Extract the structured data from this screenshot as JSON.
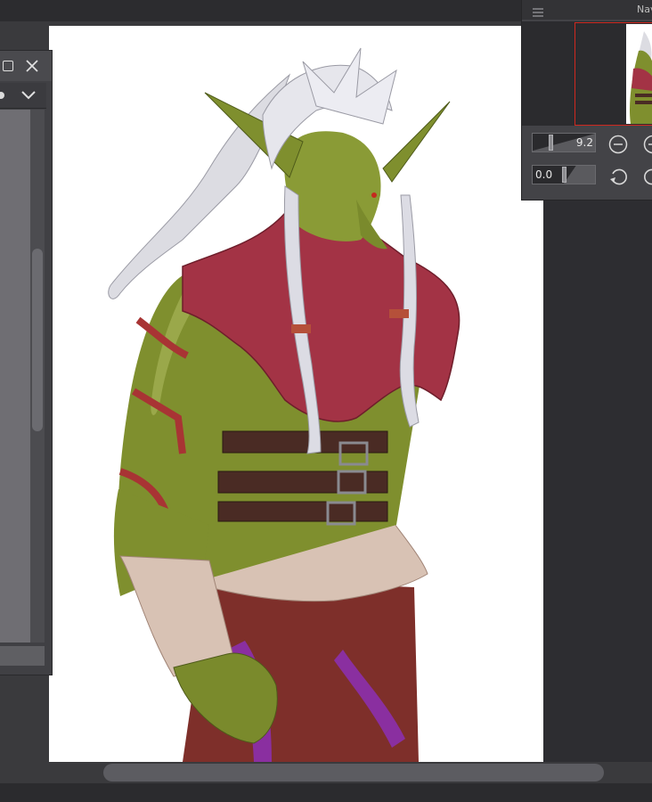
{
  "navigator": {
    "title": "Nav",
    "zoom_value": "9.2",
    "rotation_value": "0.0"
  },
  "icons": {
    "menu": "hamburger-icon",
    "zoom_out": "zoom-out-icon",
    "zoom_in": "zoom-in-icon",
    "rotate_reset": "rotate-reset-icon",
    "rotate": "rotate-icon",
    "maximize": "maximize-icon",
    "close": "close-icon",
    "dropdown": "chevron-down-icon"
  },
  "colors": {
    "canvas_bg": "#ffffff",
    "workspace_bg": "#3a3a3d",
    "navigator_frame": "#d0281f"
  }
}
